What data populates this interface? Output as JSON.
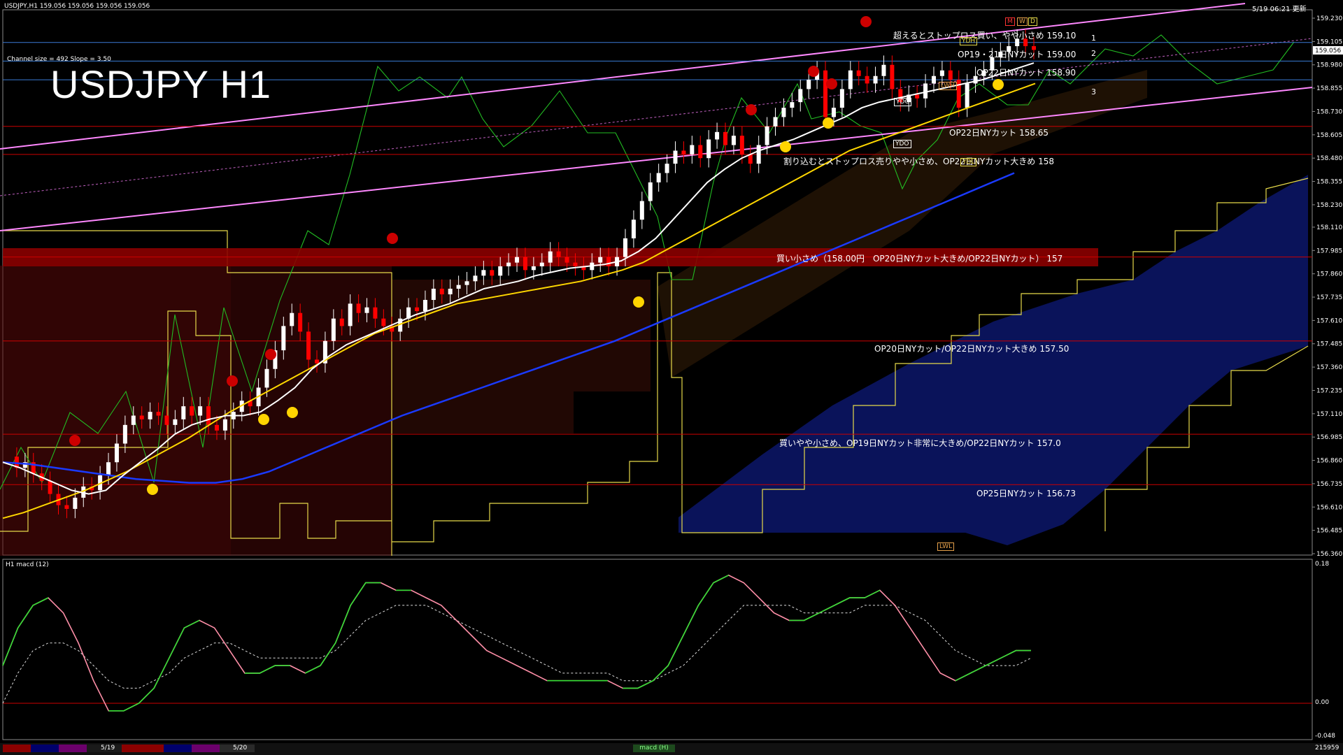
{
  "header": {
    "symbol_info": "USDJPY,H1  159.056 159.056 159.056 159.056",
    "datetime": "5/19 06:21 更新"
  },
  "watermark": "USDJPY H1",
  "channel_info": "Channel size = 492 Slope = 3.50",
  "channel_levels": [
    "1",
    "2",
    "3"
  ],
  "price_axis": [
    "159.230",
    "159.105",
    "158.980",
    "158.855",
    "158.730",
    "158.605",
    "158.480",
    "158.355",
    "158.230",
    "158.110",
    "157.985",
    "157.860",
    "157.735",
    "157.610",
    "157.485",
    "157.360",
    "157.235",
    "157.110",
    "156.985",
    "156.860",
    "156.735",
    "156.610",
    "156.485",
    "156.360"
  ],
  "current_price": "159.056",
  "levels": [
    {
      "price": 159.1,
      "label": "超えるとストップロス買い、やや小さめ 159.10"
    },
    {
      "price": 159.0,
      "label": "OP19・21日NYカット 159.00"
    },
    {
      "price": 158.9,
      "label": "OP22日NYカット 158.90"
    },
    {
      "price": 158.65,
      "label": "OP22日NYカット 158.65"
    },
    {
      "price": 158.5,
      "label": "割り込むとストップロス売りやや小さめ、OP22日NYカット大きめ 158"
    },
    {
      "price": 157.95,
      "label": "買い小さめ（158.00円　OP20日NYカット大きめ/OP22日NYカット） 157"
    },
    {
      "price": 157.5,
      "label": "OP20日NYカット/OP22日NYカット大きめ 157.50"
    },
    {
      "price": 157.0,
      "label": "買いやや小さめ、OP19日NYカット非常に大きめ/OP22日NYカット 157.0"
    },
    {
      "price": 156.73,
      "label": "OP25日NYカット 156.73"
    }
  ],
  "markers": {
    "ydh": "YDH",
    "ydc": "YDC",
    "ydo": "YDO",
    "ydl": "YDL",
    "lwh": "LWH",
    "lwl": "LWL",
    "m": "M",
    "w": "W",
    "d": "D"
  },
  "macd": {
    "title": "H1  macd (12)",
    "axis": [
      "0.18",
      "0.00",
      "-0.048"
    ]
  },
  "time_axis": {
    "labels": [
      "5/19",
      "5/20"
    ],
    "counter": "215959",
    "tab": "macd (H)"
  },
  "colors": {
    "bull": "#ffffff",
    "bear": "#ff0000",
    "ma_fast": "#ffffff",
    "ma_mid": "#ffd700",
    "ma_slow": "#1a3aff",
    "channel": "#ff80ff",
    "rsi_line": "#22cc22",
    "macd_up": "#33dd33",
    "macd_down": "#ff8fa8"
  },
  "chart_data": {
    "type": "candlestick",
    "symbol": "USDJPY",
    "timeframe": "H1",
    "ylim": [
      156.36,
      159.26
    ],
    "series": [
      {
        "name": "price",
        "values": [
          156.88,
          156.82,
          156.85,
          156.79,
          156.75,
          156.68,
          156.62,
          156.6,
          156.66,
          156.72,
          156.7,
          156.78,
          156.85,
          156.95,
          157.05,
          157.1,
          157.08,
          157.12,
          157.1,
          157.05,
          157.08,
          157.15,
          157.1,
          157.15,
          157.05,
          157.02,
          157.08,
          157.12,
          157.18,
          157.15,
          157.25,
          157.35,
          157.45,
          157.58,
          157.65,
          157.55,
          157.4,
          157.38,
          157.5,
          157.62,
          157.58,
          157.7,
          157.65,
          157.68,
          157.62,
          157.58,
          157.55,
          157.62,
          157.68,
          157.66,
          157.72,
          157.78,
          157.75,
          157.78,
          157.8,
          157.82,
          157.85,
          157.88,
          157.85,
          157.9,
          157.92,
          157.95,
          157.88,
          157.9,
          157.92,
          157.98,
          157.95,
          157.92,
          157.9,
          157.88,
          157.92,
          157.95,
          157.9,
          157.95,
          158.05,
          158.15,
          158.25,
          158.35,
          158.4,
          158.45,
          158.52,
          158.5,
          158.55,
          158.48,
          158.58,
          158.62,
          158.55,
          158.6,
          158.5,
          158.45,
          158.55,
          158.65,
          158.7,
          158.75,
          158.78,
          158.85,
          158.9,
          158.95,
          158.7,
          158.75,
          158.85,
          158.95,
          158.92,
          158.88,
          158.92,
          158.98,
          158.85,
          158.78,
          158.82,
          158.8,
          158.88,
          158.92,
          158.95,
          158.9,
          158.75,
          158.88,
          158.92,
          158.95,
          159.02,
          159.05,
          159.08,
          159.12,
          159.08,
          159.06
        ]
      },
      {
        "name": "ma_fast",
        "values": [
          156.85,
          156.82,
          156.78,
          156.74,
          156.7,
          156.68,
          156.7,
          156.78,
          156.85,
          156.92,
          157.0,
          157.05,
          157.08,
          157.1,
          157.1,
          157.12,
          157.18,
          157.25,
          157.35,
          157.42,
          157.48,
          157.52,
          157.56,
          157.6,
          157.64,
          157.67,
          157.7,
          157.74,
          157.78,
          157.8,
          157.82,
          157.85,
          157.87,
          157.89,
          157.9,
          157.91,
          157.93,
          157.98,
          158.05,
          158.15,
          158.25,
          158.35,
          158.42,
          158.48,
          158.52,
          158.55,
          158.58,
          158.62,
          158.66,
          158.7,
          158.75,
          158.78,
          158.8,
          158.82,
          158.84,
          158.86,
          158.88,
          158.9,
          158.93,
          158.96,
          158.99
        ]
      },
      {
        "name": "ma_mid",
        "values": [
          156.55,
          156.58,
          156.62,
          156.66,
          156.7,
          156.75,
          156.8,
          156.86,
          156.92,
          156.98,
          157.05,
          157.12,
          157.18,
          157.24,
          157.3,
          157.36,
          157.42,
          157.48,
          157.54,
          157.58,
          157.62,
          157.66,
          157.7,
          157.72,
          157.74,
          157.76,
          157.78,
          157.8,
          157.82,
          157.85,
          157.88,
          157.92,
          157.98,
          158.04,
          158.1,
          158.16,
          158.22,
          158.28,
          158.34,
          158.4,
          158.46,
          158.52,
          158.56,
          158.6,
          158.64,
          158.68,
          158.72,
          158.76,
          158.8,
          158.84,
          158.88
        ]
      },
      {
        "name": "ma_slow",
        "values": [
          156.85,
          156.84,
          156.82,
          156.8,
          156.78,
          156.76,
          156.75,
          156.74,
          156.74,
          156.76,
          156.8,
          156.86,
          156.92,
          156.98,
          157.04,
          157.1,
          157.15,
          157.2,
          157.25,
          157.3,
          157.35,
          157.4,
          157.45,
          157.5,
          157.56,
          157.62,
          157.68,
          157.74,
          157.8,
          157.86,
          157.92,
          157.98,
          158.04,
          158.1,
          158.16,
          158.22,
          158.28,
          158.34,
          158.4
        ]
      },
      {
        "name": "macd",
        "values": [
          0.05,
          0.1,
          0.13,
          0.14,
          0.12,
          0.08,
          0.03,
          -0.01,
          -0.01,
          0.0,
          0.02,
          0.06,
          0.1,
          0.11,
          0.1,
          0.07,
          0.04,
          0.04,
          0.05,
          0.05,
          0.04,
          0.05,
          0.08,
          0.13,
          0.16,
          0.16,
          0.15,
          0.15,
          0.14,
          0.13,
          0.11,
          0.09,
          0.07,
          0.06,
          0.05,
          0.04,
          0.03,
          0.03,
          0.03,
          0.03,
          0.03,
          0.02,
          0.02,
          0.03,
          0.05,
          0.09,
          0.13,
          0.16,
          0.17,
          0.16,
          0.14,
          0.12,
          0.11,
          0.11,
          0.12,
          0.13,
          0.14,
          0.14,
          0.15,
          0.13,
          0.1,
          0.07,
          0.04,
          0.03,
          0.04,
          0.05,
          0.06,
          0.07,
          0.07
        ]
      },
      {
        "name": "signal",
        "values": [
          0.0,
          0.04,
          0.07,
          0.08,
          0.08,
          0.07,
          0.05,
          0.03,
          0.02,
          0.02,
          0.03,
          0.04,
          0.06,
          0.07,
          0.08,
          0.08,
          0.07,
          0.06,
          0.06,
          0.06,
          0.06,
          0.06,
          0.07,
          0.09,
          0.11,
          0.12,
          0.13,
          0.13,
          0.13,
          0.12,
          0.11,
          0.1,
          0.09,
          0.08,
          0.07,
          0.06,
          0.05,
          0.04,
          0.04,
          0.04,
          0.04,
          0.03,
          0.03,
          0.03,
          0.04,
          0.05,
          0.07,
          0.09,
          0.11,
          0.13,
          0.13,
          0.13,
          0.13,
          0.12,
          0.12,
          0.12,
          0.12,
          0.13,
          0.13,
          0.13,
          0.12,
          0.11,
          0.09,
          0.07,
          0.06,
          0.05,
          0.05,
          0.05,
          0.06
        ]
      }
    ]
  }
}
